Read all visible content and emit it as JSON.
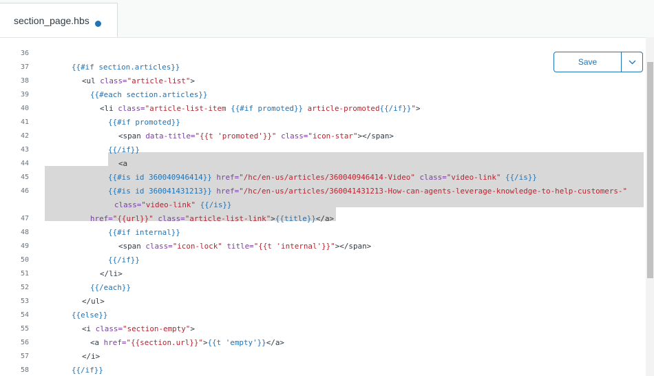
{
  "tab": {
    "filename": "section_page.hbs"
  },
  "toolbar": {
    "save_label": "Save"
  },
  "colors": {
    "accent": "#1f73b7",
    "keyword": "#1f73b7",
    "attribute": "#7a3ea6",
    "string": "#b8242f",
    "selection": "#d8d8d8"
  },
  "icons": {
    "unsaved": "unsaved-dot-icon",
    "dropdown": "chevron-down-icon"
  },
  "lines": [
    {
      "num": "36",
      "segments": []
    },
    {
      "num": "37",
      "segments": [
        [
          "k",
          "{{#if section.articles}}"
        ]
      ]
    },
    {
      "num": "38",
      "segments": [
        [
          "t",
          "<ul "
        ],
        [
          "a",
          "class="
        ],
        [
          "s",
          "\"article-list\""
        ],
        [
          "t",
          ">"
        ]
      ]
    },
    {
      "num": "39",
      "segments": [
        [
          "k",
          "{{#each section.articles}}"
        ]
      ]
    },
    {
      "num": "40",
      "segments": [
        [
          "t",
          "<li "
        ],
        [
          "a",
          "class="
        ],
        [
          "s",
          "\"article-list-item "
        ],
        [
          "k",
          "{{#if promoted}}"
        ],
        [
          "s",
          " article-promoted"
        ],
        [
          "k",
          "{{/if}}"
        ],
        [
          "s",
          "\""
        ],
        [
          "t",
          ">"
        ]
      ]
    },
    {
      "num": "41",
      "segments": [
        [
          "k",
          "{{#if promoted}}"
        ]
      ]
    },
    {
      "num": "42",
      "segments": [
        [
          "t",
          "<span "
        ],
        [
          "a",
          "data-title="
        ],
        [
          "s",
          "\"{{t 'promoted'}}\""
        ],
        [
          "t",
          " "
        ],
        [
          "a",
          "class="
        ],
        [
          "s",
          "\"icon-star\""
        ],
        [
          "t",
          "></span>"
        ]
      ]
    },
    {
      "num": "43",
      "segments": [
        [
          "k",
          "{{/if}}"
        ]
      ]
    },
    {
      "num": "44",
      "segments": [
        [
          "t",
          "<a"
        ]
      ]
    },
    {
      "num": "45",
      "segments": [
        [
          "k",
          "{{#is id 360040946414}}"
        ],
        [
          "t",
          " "
        ],
        [
          "a",
          "href="
        ],
        [
          "s",
          "\"/hc/en-us/articles/360040946414-Video\""
        ],
        [
          "t",
          " "
        ],
        [
          "a",
          "class="
        ],
        [
          "s",
          "\"video-link\""
        ],
        [
          "t",
          " "
        ],
        [
          "k",
          "{{/is}}"
        ]
      ]
    },
    {
      "num": "46",
      "segments": [
        [
          "k",
          "{{#is id 360041431213}}"
        ],
        [
          "t",
          " "
        ],
        [
          "a",
          "href="
        ],
        [
          "s",
          "\"/hc/en-us/articles/360041431213-How-can-agents-leverage-knowledge-to-help-customers-\""
        ]
      ]
    },
    {
      "num": "",
      "segments": [
        [
          "a",
          "class="
        ],
        [
          "s",
          "\"video-link\""
        ],
        [
          "t",
          " "
        ],
        [
          "k",
          "{{/is}}"
        ]
      ]
    },
    {
      "num": "47",
      "segments": [
        [
          "a",
          "href="
        ],
        [
          "s",
          "\"{{url}}\""
        ],
        [
          "t",
          " "
        ],
        [
          "a",
          "class="
        ],
        [
          "s",
          "\"article-list-link\""
        ],
        [
          "t",
          ">"
        ],
        [
          "k",
          "{{title}}"
        ],
        [
          "t",
          "</a>"
        ]
      ]
    },
    {
      "num": "48",
      "segments": [
        [
          "k",
          "{{#if internal}}"
        ]
      ]
    },
    {
      "num": "49",
      "segments": [
        [
          "t",
          "<span "
        ],
        [
          "a",
          "class="
        ],
        [
          "s",
          "\"icon-lock\""
        ],
        [
          "t",
          " "
        ],
        [
          "a",
          "title="
        ],
        [
          "s",
          "\"{{t 'internal'}}\""
        ],
        [
          "t",
          "></span>"
        ]
      ]
    },
    {
      "num": "50",
      "segments": [
        [
          "k",
          "{{/if}}"
        ]
      ]
    },
    {
      "num": "51",
      "segments": [
        [
          "t",
          "</li>"
        ]
      ]
    },
    {
      "num": "52",
      "segments": [
        [
          "k",
          "{{/each}}"
        ]
      ]
    },
    {
      "num": "53",
      "segments": [
        [
          "t",
          "</ul>"
        ]
      ]
    },
    {
      "num": "54",
      "segments": [
        [
          "k",
          "{{else}}"
        ]
      ]
    },
    {
      "num": "55",
      "segments": [
        [
          "t",
          "<i "
        ],
        [
          "a",
          "class="
        ],
        [
          "s",
          "\"section-empty\""
        ],
        [
          "t",
          ">"
        ]
      ]
    },
    {
      "num": "56",
      "segments": [
        [
          "t",
          "<a "
        ],
        [
          "a",
          "href="
        ],
        [
          "s",
          "\"{{section.url}}\""
        ],
        [
          "t",
          ">"
        ],
        [
          "k",
          "{{t 'empty'}}"
        ],
        [
          "t",
          "</a>"
        ]
      ]
    },
    {
      "num": "57",
      "segments": [
        [
          "t",
          "</i>"
        ]
      ]
    },
    {
      "num": "58",
      "segments": [
        [
          "k",
          "{{/if}}"
        ]
      ]
    }
  ]
}
